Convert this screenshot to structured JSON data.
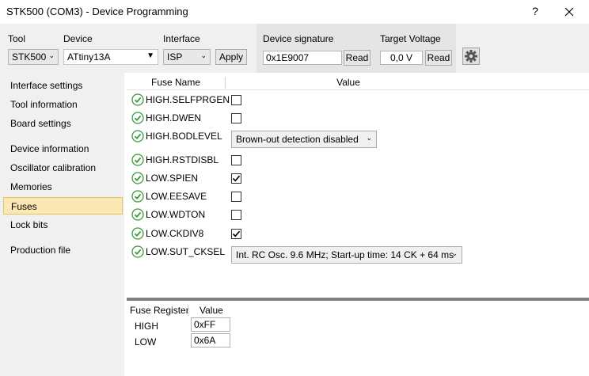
{
  "window": {
    "title": "STK500 (COM3) - Device Programming",
    "help_label": "?"
  },
  "toolbar": {
    "tool_label": "Tool",
    "tool_value": "STK500",
    "device_label": "Device",
    "device_value": "ATtiny13A",
    "interface_label": "Interface",
    "interface_value": "ISP",
    "apply_label": "Apply",
    "signature_label": "Device signature",
    "signature_value": "0x1E9007",
    "signature_read_label": "Read",
    "voltage_label": "Target Voltage",
    "voltage_value": "0,0 V",
    "voltage_read_label": "Read"
  },
  "sidebar": {
    "items": [
      {
        "label": "Interface settings"
      },
      {
        "label": "Tool information"
      },
      {
        "label": "Board settings"
      },
      {
        "label": "Device information"
      },
      {
        "label": "Oscillator calibration"
      },
      {
        "label": "Memories"
      },
      {
        "label": "Fuses"
      },
      {
        "label": "Lock bits"
      },
      {
        "label": "Production file"
      }
    ],
    "active": "Fuses"
  },
  "fuses": {
    "header_name": "Fuse Name",
    "header_value": "Value",
    "rows": [
      {
        "name": "HIGH.SELFPRGEN",
        "type": "checkbox",
        "checked": false
      },
      {
        "name": "HIGH.DWEN",
        "type": "checkbox",
        "checked": false
      },
      {
        "name": "HIGH.BODLEVEL",
        "type": "select",
        "value": "Brown-out detection disabled"
      },
      {
        "name": "HIGH.RSTDISBL",
        "type": "checkbox",
        "checked": false
      },
      {
        "name": "LOW.SPIEN",
        "type": "checkbox",
        "checked": true
      },
      {
        "name": "LOW.EESAVE",
        "type": "checkbox",
        "checked": false
      },
      {
        "name": "LOW.WDTON",
        "type": "checkbox",
        "checked": false
      },
      {
        "name": "LOW.CKDIV8",
        "type": "checkbox",
        "checked": true
      },
      {
        "name": "LOW.SUT_CKSEL",
        "type": "select",
        "value": "Int. RC Osc. 9.6 MHz; Start-up time: 14 CK + 64 ms"
      }
    ]
  },
  "registers": {
    "header_name": "Fuse Register",
    "header_value": "Value",
    "rows": [
      {
        "name": "HIGH",
        "value": "0xFF"
      },
      {
        "name": "LOW",
        "value": "0x6A"
      }
    ]
  },
  "colors": {
    "ok_green": "#3a9a3a",
    "active_nav_bg": "#fce8b2",
    "toolbar_bg": "#f0f0f0"
  }
}
